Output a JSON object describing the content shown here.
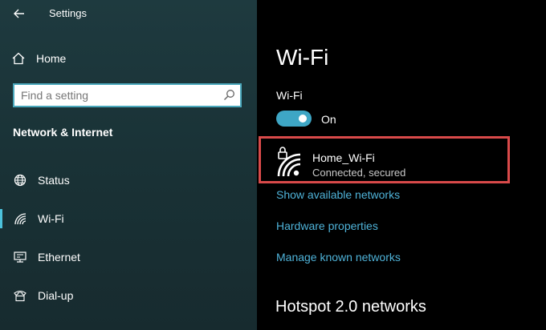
{
  "window": {
    "title": "Settings"
  },
  "sidebar": {
    "home_label": "Home",
    "search_placeholder": "Find a setting",
    "section_title": "Network & Internet",
    "items": [
      {
        "label": "Status",
        "icon": "globe-icon"
      },
      {
        "label": "Wi-Fi",
        "icon": "wifi-icon",
        "selected": true
      },
      {
        "label": "Ethernet",
        "icon": "ethernet-icon"
      },
      {
        "label": "Dial-up",
        "icon": "phone-icon"
      }
    ]
  },
  "main": {
    "title": "Wi-Fi",
    "wifi_label": "Wi-Fi",
    "toggle_state": "On",
    "network": {
      "name": "Home_Wi-Fi",
      "status": "Connected, secured"
    },
    "links": [
      "Show available networks",
      "Hardware properties",
      "Manage known networks"
    ],
    "hotspot_title": "Hotspot 2.0 networks"
  },
  "colors": {
    "accent": "#3ea6c5",
    "link": "#4fb3d9",
    "highlight_border": "#d94a4a",
    "sidebar_bg": "#1e3a3f"
  }
}
